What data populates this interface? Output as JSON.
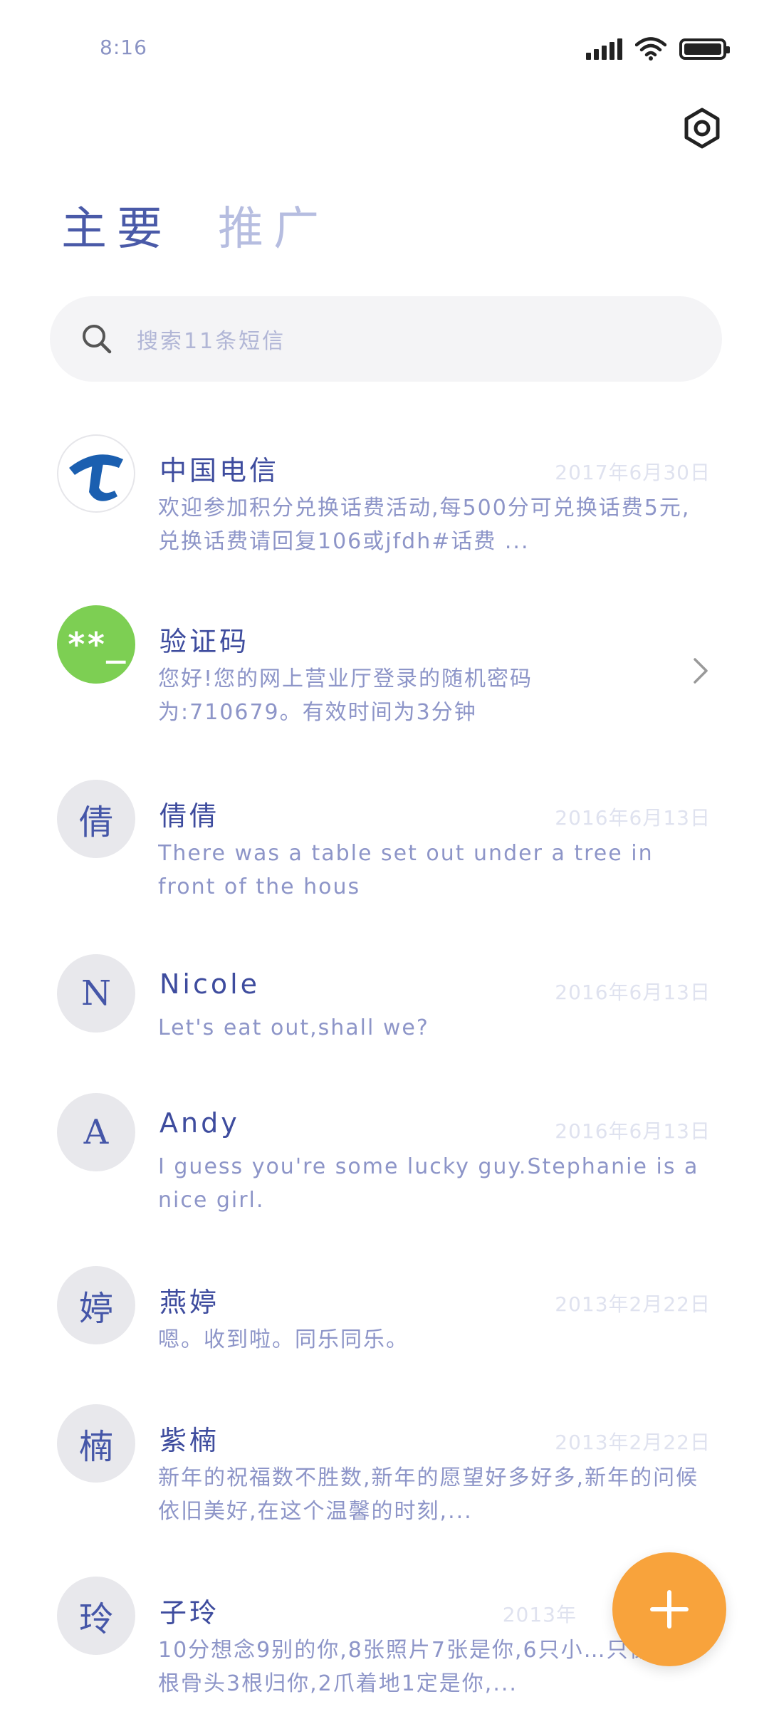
{
  "status_bar": {
    "time": "8:16",
    "icons": [
      "signal-icon",
      "wifi-icon",
      "battery-icon"
    ]
  },
  "header": {
    "settings_icon": "settings-icon"
  },
  "tabs": [
    {
      "label": "主要",
      "active": true
    },
    {
      "label": "推广",
      "active": false
    }
  ],
  "search": {
    "placeholder": "搜索11条短信"
  },
  "conversations": [
    {
      "avatar_type": "logo",
      "avatar_icon": "china-telecom-logo",
      "name": "中国电信",
      "date": "2017年6月30日",
      "preview": "欢迎参加积分兑换话费活动,每500分可兑换话费5元,兑换话费请回复106或jfdh#话费 ..."
    },
    {
      "avatar_type": "text",
      "avatar_text": "**_",
      "avatar_color": "#7dcf53",
      "name": "验证码",
      "date": "",
      "preview": "您好!您的网上营业厅登录的随机密码为:710679。有效时间为3分钟",
      "chevron_icon": "chevron-right-icon"
    },
    {
      "avatar_type": "text",
      "avatar_text": "倩",
      "name": "倩倩",
      "date": "2016年6月13日",
      "preview": "There was a table set out under a tree in front of the hous"
    },
    {
      "avatar_type": "text",
      "avatar_text": "N",
      "name": "Nicole",
      "date": "2016年6月13日",
      "preview": "Let's eat out,shall we?"
    },
    {
      "avatar_type": "text",
      "avatar_text": "A",
      "name": "Andy",
      "date": "2016年6月13日",
      "preview": "I guess you're some lucky guy.Stephanie is a nice girl."
    },
    {
      "avatar_type": "text",
      "avatar_text": "婷",
      "name": "燕婷",
      "date": "2013年2月22日",
      "preview": "嗯。收到啦。同乐同乐。"
    },
    {
      "avatar_type": "text",
      "avatar_text": "楠",
      "name": "紫楠",
      "date": "2013年2月22日",
      "preview": "新年的祝福数不胜数,新年的愿望好多好多,新年的问候依旧美好,在这个温馨的时刻,..."
    },
    {
      "avatar_type": "text",
      "avatar_text": "玲",
      "name": "子玲",
      "date": "2013年",
      "preview": "10分想念9别的你,8张照片7张是你,6只小…只像你,4根骨头3根归你,2爪着地1定是你,..."
    }
  ],
  "fab": {
    "icon": "plus-icon",
    "color": "#f8a33c"
  }
}
